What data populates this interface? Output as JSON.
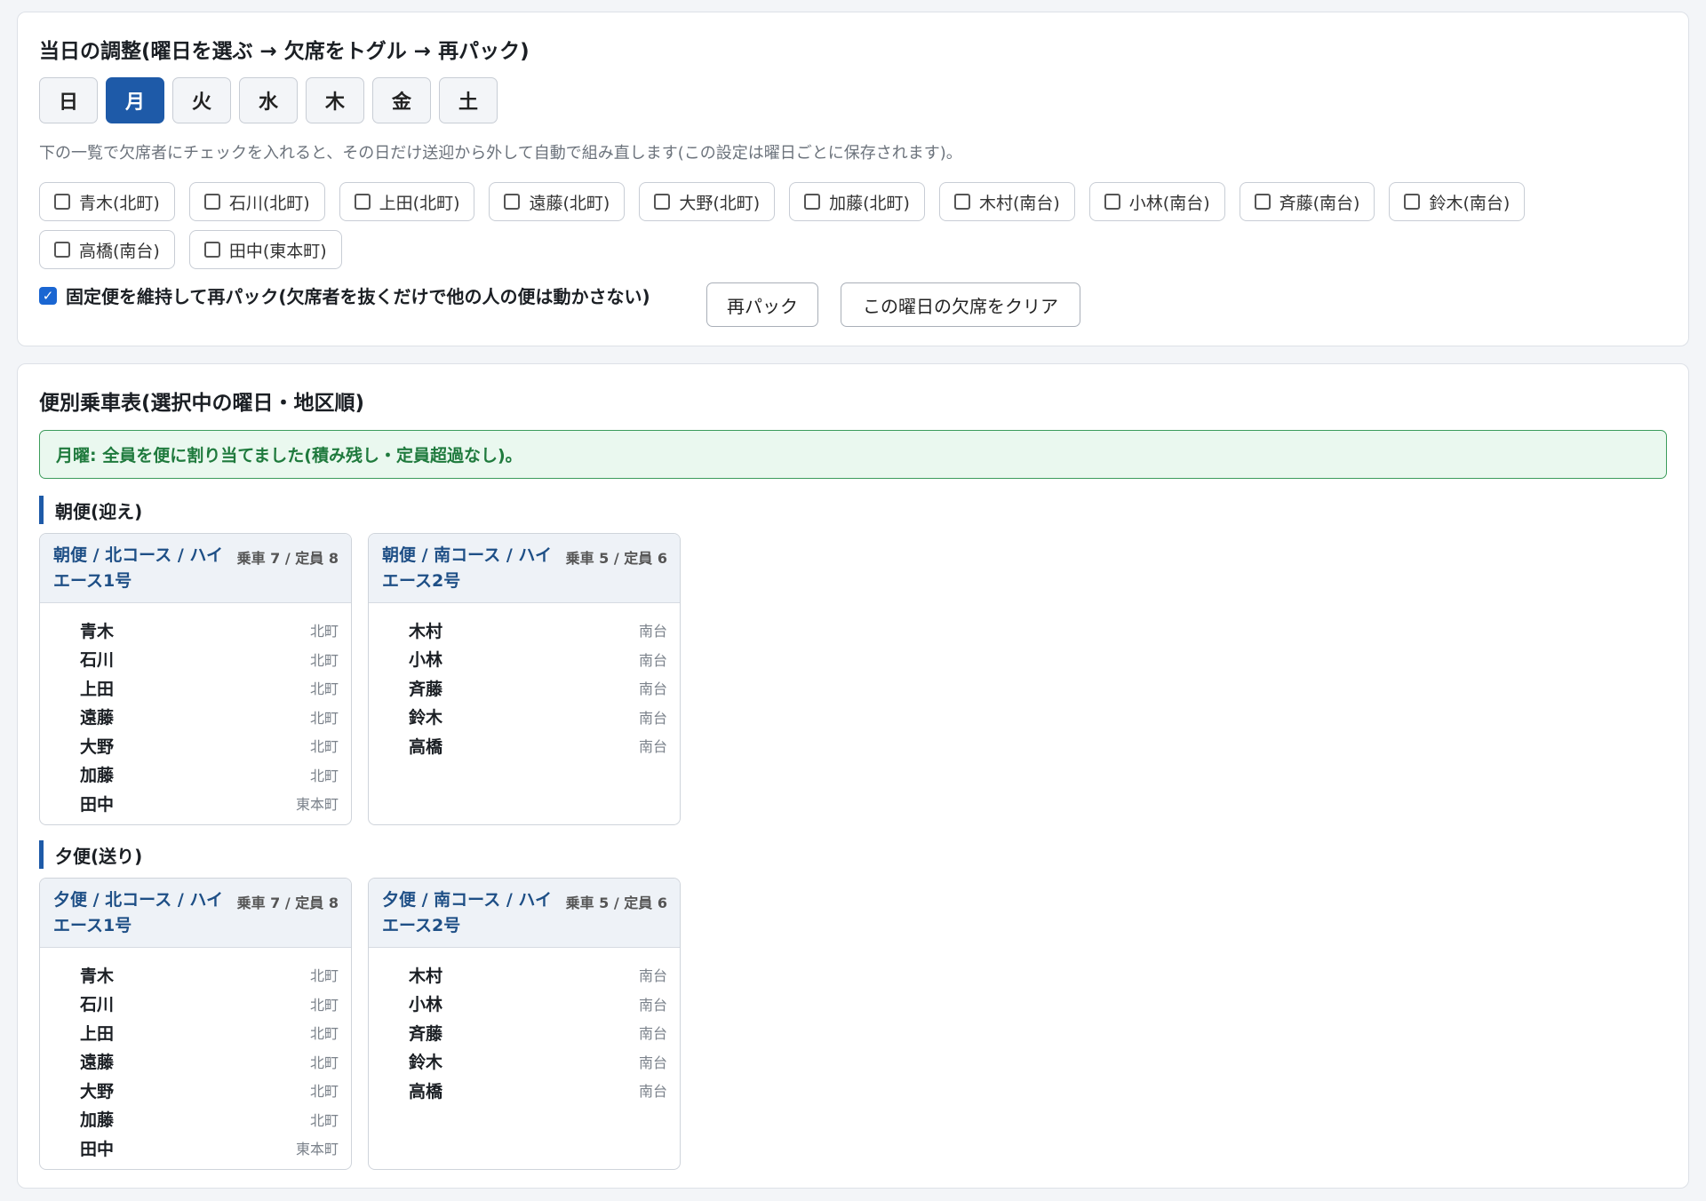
{
  "adjust": {
    "title": "当日の調整(曜日を選ぶ → 欠席をトグル → 再パック)",
    "days": [
      {
        "label": "日",
        "active": false
      },
      {
        "label": "月",
        "active": true
      },
      {
        "label": "火",
        "active": false
      },
      {
        "label": "水",
        "active": false
      },
      {
        "label": "木",
        "active": false
      },
      {
        "label": "金",
        "active": false
      },
      {
        "label": "土",
        "active": false
      }
    ],
    "help": "下の一覧で欠席者にチェックを入れると、その日だけ送迎から外して自動で組み直します(この設定は曜日ごとに保存されます)。",
    "absentees": [
      {
        "label": "青木(北町)",
        "checked": false
      },
      {
        "label": "石川(北町)",
        "checked": false
      },
      {
        "label": "上田(北町)",
        "checked": false
      },
      {
        "label": "遠藤(北町)",
        "checked": false
      },
      {
        "label": "大野(北町)",
        "checked": false
      },
      {
        "label": "加藤(北町)",
        "checked": false
      },
      {
        "label": "木村(南台)",
        "checked": false
      },
      {
        "label": "小林(南台)",
        "checked": false
      },
      {
        "label": "斉藤(南台)",
        "checked": false
      },
      {
        "label": "鈴木(南台)",
        "checked": false
      },
      {
        "label": "高橋(南台)",
        "checked": false
      },
      {
        "label": "田中(東本町)",
        "checked": false
      }
    ],
    "keep_fixed": {
      "checked": true,
      "label": "固定便を維持して再パック(欠席者を抜くだけで他の人の便は動かさない)"
    },
    "repack_label": "再パック",
    "clear_label": "この曜日の欠席をクリア"
  },
  "table": {
    "title": "便別乗車表(選択中の曜日・地区順)",
    "status": "月曜: 全員を便に割り当てました(積み残し・定員超過なし)。",
    "morning": {
      "heading": "朝便(迎え)",
      "north": {
        "title": "朝便 / 北コース / ハイエース1号",
        "count": "乗車 7 / 定員 8",
        "riders": [
          {
            "name": "青木",
            "area": "北町"
          },
          {
            "name": "石川",
            "area": "北町"
          },
          {
            "name": "上田",
            "area": "北町"
          },
          {
            "name": "遠藤",
            "area": "北町"
          },
          {
            "name": "大野",
            "area": "北町"
          },
          {
            "name": "加藤",
            "area": "北町"
          },
          {
            "name": "田中",
            "area": "東本町"
          }
        ]
      },
      "south": {
        "title": "朝便 / 南コース / ハイエース2号",
        "count": "乗車 5 / 定員 6",
        "riders": [
          {
            "name": "木村",
            "area": "南台"
          },
          {
            "name": "小林",
            "area": "南台"
          },
          {
            "name": "斉藤",
            "area": "南台"
          },
          {
            "name": "鈴木",
            "area": "南台"
          },
          {
            "name": "高橋",
            "area": "南台"
          }
        ]
      }
    },
    "evening": {
      "heading": "夕便(送り)",
      "north": {
        "title": "夕便 / 北コース / ハイエース1号",
        "count": "乗車 7 / 定員 8",
        "riders": [
          {
            "name": "青木",
            "area": "北町"
          },
          {
            "name": "石川",
            "area": "北町"
          },
          {
            "name": "上田",
            "area": "北町"
          },
          {
            "name": "遠藤",
            "area": "北町"
          },
          {
            "name": "大野",
            "area": "北町"
          },
          {
            "name": "加藤",
            "area": "北町"
          },
          {
            "name": "田中",
            "area": "東本町"
          }
        ]
      },
      "south": {
        "title": "夕便 / 南コース / ハイエース2号",
        "count": "乗車 5 / 定員 6",
        "riders": [
          {
            "name": "木村",
            "area": "南台"
          },
          {
            "name": "小林",
            "area": "南台"
          },
          {
            "name": "斉藤",
            "area": "南台"
          },
          {
            "name": "鈴木",
            "area": "南台"
          },
          {
            "name": "高橋",
            "area": "南台"
          }
        ]
      }
    }
  }
}
